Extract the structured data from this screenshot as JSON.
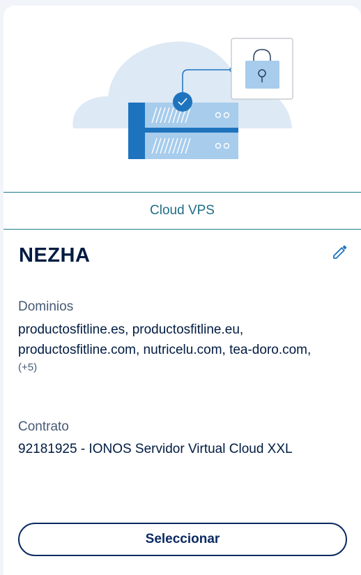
{
  "card": {
    "product_type": "Cloud VPS",
    "server_name": "NEZHA",
    "icons": {
      "illustration": "cloud-server-lock-illustration",
      "edit": "pencil-icon"
    },
    "domains": {
      "label": "Dominios",
      "line1": "productosfitline.es, productosfitline.eu,",
      "line2": "productosfitline.com, nutricelu.com, tea-doro.com,",
      "more": "(+5)"
    },
    "contract": {
      "label": "Contrato",
      "value": "92181925 - IONOS Servidor Virtual Cloud XXL"
    },
    "select_button_label": "Seleccionar"
  },
  "colors": {
    "accent": "#1f6d86",
    "navy": "#001b41",
    "button_border": "#0b2a63",
    "icon_blue": "#1e73be",
    "light_blue": "#a7ccec",
    "cloud": "#dde9f5",
    "page_bg": "#f1f4f8"
  }
}
